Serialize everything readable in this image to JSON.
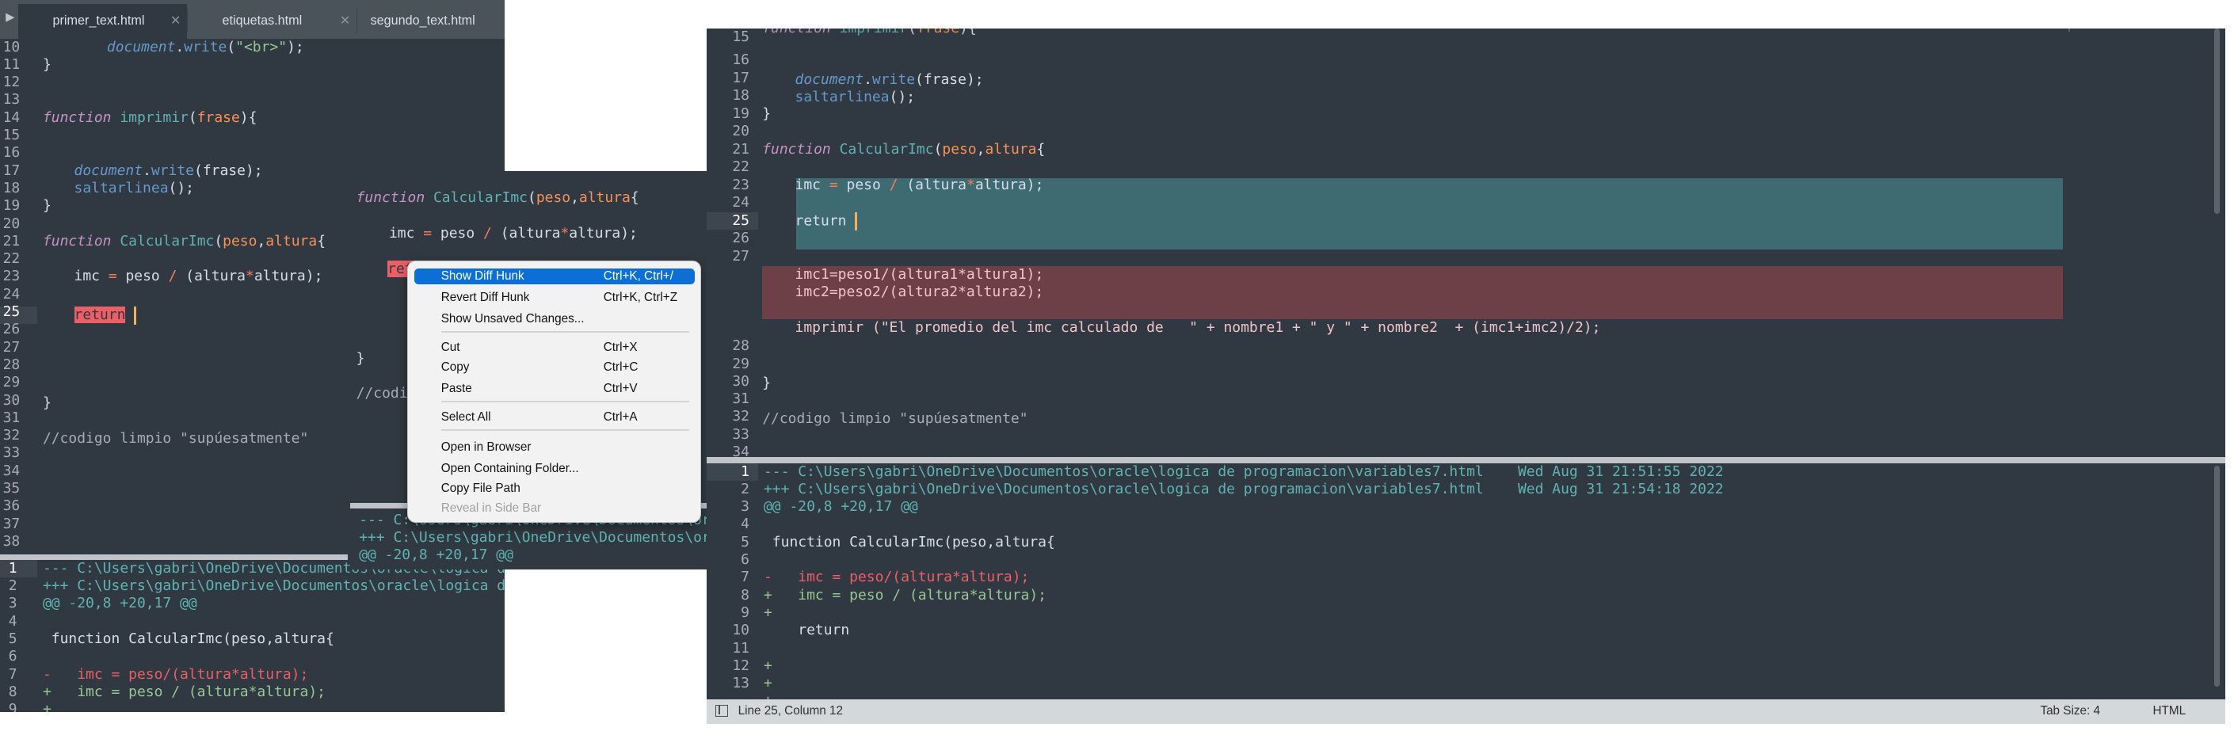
{
  "tabs": [
    {
      "label": "primer_text.html",
      "active": true
    },
    {
      "label": "etiquetas.html",
      "active": false
    },
    {
      "label": "segundo_text.html",
      "active": false
    }
  ],
  "left_editor": {
    "current_line": "25",
    "lines": [
      {
        "n": "10"
      },
      {
        "n": "11"
      },
      {
        "n": "12"
      },
      {
        "n": "13"
      },
      {
        "n": "14"
      },
      {
        "n": "15"
      },
      {
        "n": "16"
      },
      {
        "n": "17"
      },
      {
        "n": "18"
      },
      {
        "n": "19"
      },
      {
        "n": "20"
      },
      {
        "n": "21"
      },
      {
        "n": "22"
      },
      {
        "n": "23"
      },
      {
        "n": "24"
      },
      {
        "n": "25"
      },
      {
        "n": "26"
      },
      {
        "n": "27"
      },
      {
        "n": "28"
      },
      {
        "n": "29"
      },
      {
        "n": "30"
      },
      {
        "n": "31"
      },
      {
        "n": "32"
      },
      {
        "n": "33"
      },
      {
        "n": "34"
      },
      {
        "n": "35"
      },
      {
        "n": "36"
      },
      {
        "n": "37"
      },
      {
        "n": "38"
      }
    ]
  },
  "code": {
    "kw_function": "function",
    "fn_imprimir": "imprimir",
    "fn_calcular": "CalcularImc",
    "p_frase": "frase",
    "p_peso": "peso",
    "p_altura": "altura",
    "document": "document",
    "write": "write",
    "br_string": "\"<br>\"",
    "saltarlinea": "saltarlinea",
    "imc_lhs": "imc",
    "peso_plain": "peso",
    "altura_plain": "altura",
    "return": "return",
    "comment": "//codigo limpio \"supúesatmente\"",
    "comment_short": "//codi",
    "brace_close": "}",
    "brace_open": "{",
    "paren_open": "(",
    "paren_close": ")",
    "comma": ",",
    "semicolon": ";",
    "eq": "=",
    "div": "/",
    "mul": "*",
    "dot": "."
  },
  "left_diff": {
    "line_numbers": [
      "1",
      "2",
      "3",
      "4",
      "5",
      "6",
      "7",
      "8",
      "9"
    ],
    "hdr_minus": "--- C:\\Users\\gabri\\OneDrive\\Documentos\\oracle\\logica de",
    "hdr_plus": "+++ C:\\Users\\gabri\\OneDrive\\Documentos\\oracle\\logica de p",
    "at": "@@ -20,8 +20,17 @@",
    "ctx_function": " function CalcularImc(peso,altura{",
    "minus_line": "-   imc = peso/(altura*altura);",
    "plus_line": "+   imc = peso / (altura*altura);",
    "plus_only": "+"
  },
  "mid_diff": {
    "hdr_minus": "--- C:\\Users\\gabri\\OneDrive\\Documentos\\oracle",
    "hdr_plus": "+++ C:\\Users\\gabri\\OneDrive\\Documentos\\oracle",
    "at": "@@ -20,8 +20,17 @@"
  },
  "context_menu": {
    "items": [
      {
        "label": "Show Diff Hunk",
        "shortcut": "Ctrl+K, Ctrl+/",
        "highlighted": true
      },
      {
        "label": "Revert Diff Hunk",
        "shortcut": "Ctrl+K, Ctrl+Z"
      },
      {
        "label": "Show Unsaved Changes...",
        "shortcut": ""
      },
      {
        "label": "Cut",
        "shortcut": "Ctrl+X"
      },
      {
        "label": "Copy",
        "shortcut": "Ctrl+C"
      },
      {
        "label": "Paste",
        "shortcut": "Ctrl+V"
      },
      {
        "label": "Select All",
        "shortcut": "Ctrl+A"
      },
      {
        "label": "Open in Browser",
        "shortcut": ""
      },
      {
        "label": "Open Containing Folder...",
        "shortcut": ""
      },
      {
        "label": "Copy File Path",
        "shortcut": ""
      },
      {
        "label": "Reveal in Side Bar",
        "shortcut": "",
        "disabled": true
      }
    ]
  },
  "right_editor": {
    "line_numbers_top": [
      "15",
      "16",
      "17",
      "18",
      "19",
      "20",
      "21",
      "22",
      "23",
      "24",
      "25",
      "26",
      "27"
    ],
    "line_numbers_bottom": [
      "28",
      "29",
      "30",
      "31",
      "32",
      "33",
      "34"
    ],
    "current_line": "25",
    "deleted_lines": {
      "imc1": "imc1=peso1/(altura1*altura1);",
      "imc2": "imc2=peso2/(altura2*altura2);",
      "imprimir_call": "imprimir (\"El promedio del imc calculado de   \" + nombre1 + \" y \" + nombre2  + (imc1+imc2)/2);"
    }
  },
  "right_diff": {
    "line_numbers": [
      "1",
      "2",
      "3",
      "4",
      "5",
      "6",
      "7",
      "8",
      "9",
      "10",
      "11",
      "12",
      "13"
    ],
    "current_line": "1",
    "hdr_minus": "--- C:\\Users\\gabri\\OneDrive\\Documentos\\oracle\\logica de programacion\\variables7.html    Wed Aug 31 21:51:55 2022",
    "hdr_plus": "+++ C:\\Users\\gabri\\OneDrive\\Documentos\\oracle\\logica de programacion\\variables7.html    Wed Aug 31 21:54:18 2022",
    "at": "@@ -20,8 +20,17 @@",
    "ctx_function": " function CalcularImc(peso,altura{",
    "minus_line": "-   imc = peso/(altura*altura);",
    "plus_line": "+   imc = peso / (altura*altura);",
    "plus_only": "+",
    "return_ctx": "    return"
  },
  "status_bar": {
    "position": "Line 25, Column 12",
    "tab_size": "Tab Size: 4",
    "syntax": "HTML"
  },
  "colors": {
    "editor_bg": "#303841",
    "teal_hunk": "#3e6a71",
    "red_hunk": "#6d3f47",
    "menu_highlight": "#0b6fd6"
  }
}
